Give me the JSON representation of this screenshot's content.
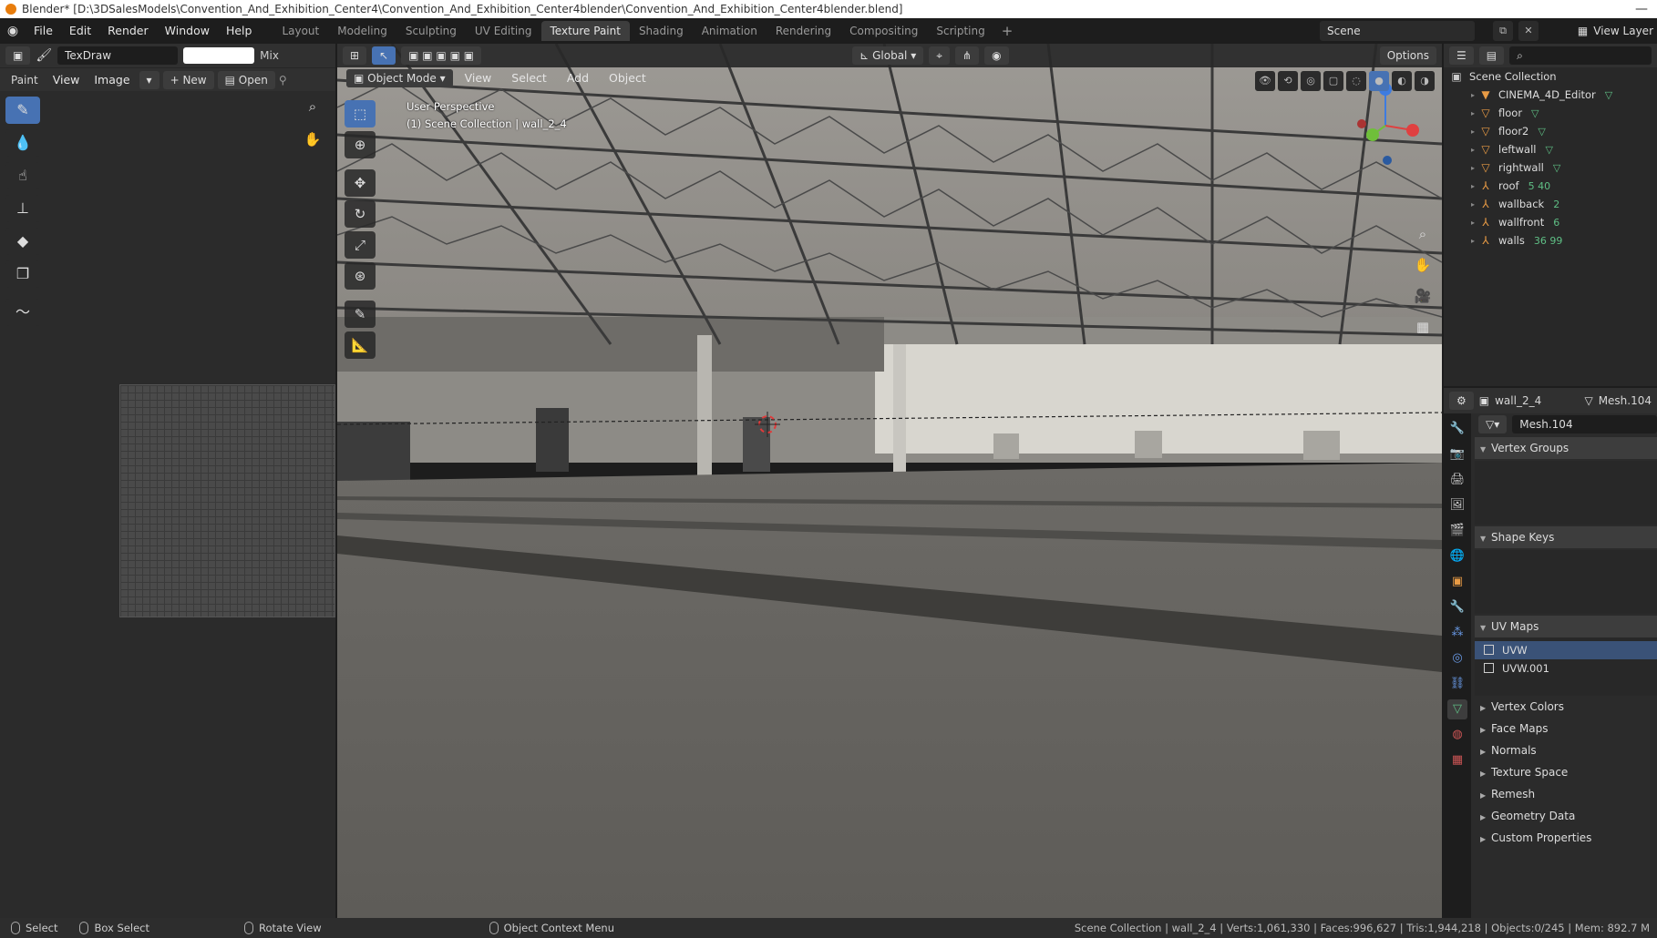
{
  "titlebar": {
    "text": "Blender* [D:\\3DSalesModels\\Convention_And_Exhibition_Center4\\Convention_And_Exhibition_Center4blender\\Convention_And_Exhibition_Center4blender.blend]",
    "controls": "—"
  },
  "menubar": {
    "items": [
      "File",
      "Edit",
      "Render",
      "Window",
      "Help"
    ],
    "workspaces": [
      "Layout",
      "Modeling",
      "Sculpting",
      "UV Editing",
      "Texture Paint",
      "Shading",
      "Animation",
      "Rendering",
      "Compositing",
      "Scripting"
    ],
    "active_workspace": "Texture Paint",
    "add_label": "+",
    "scene": "Scene",
    "view_layer": "View Layer"
  },
  "image_editor": {
    "brush_name": "TexDraw",
    "blend_mode": "Mix",
    "mode": "Paint",
    "menu": [
      "View",
      "Image"
    ],
    "new_label": "New",
    "open_label": "Open"
  },
  "viewport": {
    "mode": "Object Mode",
    "menu": [
      "View",
      "Select",
      "Add",
      "Object"
    ],
    "transform_orientation": "Global",
    "options_label": "Options",
    "perspective": "User Perspective",
    "collection_info": "(1) Scene Collection | wall_2_4"
  },
  "outliner": {
    "root": "Scene Collection",
    "items": [
      {
        "name": "CINEMA_4D_Editor",
        "icon": "camera-icon",
        "extra": "",
        "tri": "▸"
      },
      {
        "name": "floor",
        "icon": "mesh-icon",
        "extra": "",
        "tri": "▸"
      },
      {
        "name": "floor2",
        "icon": "mesh-icon",
        "extra": "",
        "tri": "▸"
      },
      {
        "name": "leftwall",
        "icon": "mesh-icon",
        "extra": "",
        "tri": "▸"
      },
      {
        "name": "rightwall",
        "icon": "mesh-icon",
        "extra": "",
        "tri": "▸"
      },
      {
        "name": "roof",
        "icon": "empty-icon",
        "extra": "5  40",
        "tri": "▸"
      },
      {
        "name": "wallback",
        "icon": "empty-icon",
        "extra": "2",
        "tri": "▸"
      },
      {
        "name": "wallfront",
        "icon": "empty-icon",
        "extra": "6",
        "tri": "▸"
      },
      {
        "name": "walls",
        "icon": "empty-icon",
        "extra": "36  99",
        "tri": "▸"
      }
    ]
  },
  "properties": {
    "object_name": "wall_2_4",
    "mesh_name": "Mesh.104",
    "data_name": "Mesh.104",
    "sections_open": [
      "Vertex Groups",
      "Shape Keys",
      "UV Maps"
    ],
    "uv_maps": [
      "UVW",
      "UVW.001"
    ],
    "sections_closed": [
      "Vertex Colors",
      "Face Maps",
      "Normals",
      "Texture Space",
      "Remesh",
      "Geometry Data",
      "Custom Properties"
    ]
  },
  "statusbar": {
    "select": "Select",
    "box_select": "Box Select",
    "rotate_view": "Rotate View",
    "context_menu": "Object Context Menu",
    "stats": "Scene Collection | wall_2_4 | Verts:1,061,330 | Faces:996,627 | Tris:1,944,218 | Objects:0/245 | Mem: 892.7 M"
  },
  "colors": {
    "accent": "#4772b3",
    "panel": "#2b2b2b",
    "header": "#303030",
    "orange_icon": "#e89b45",
    "green_icon": "#5fbf85"
  }
}
